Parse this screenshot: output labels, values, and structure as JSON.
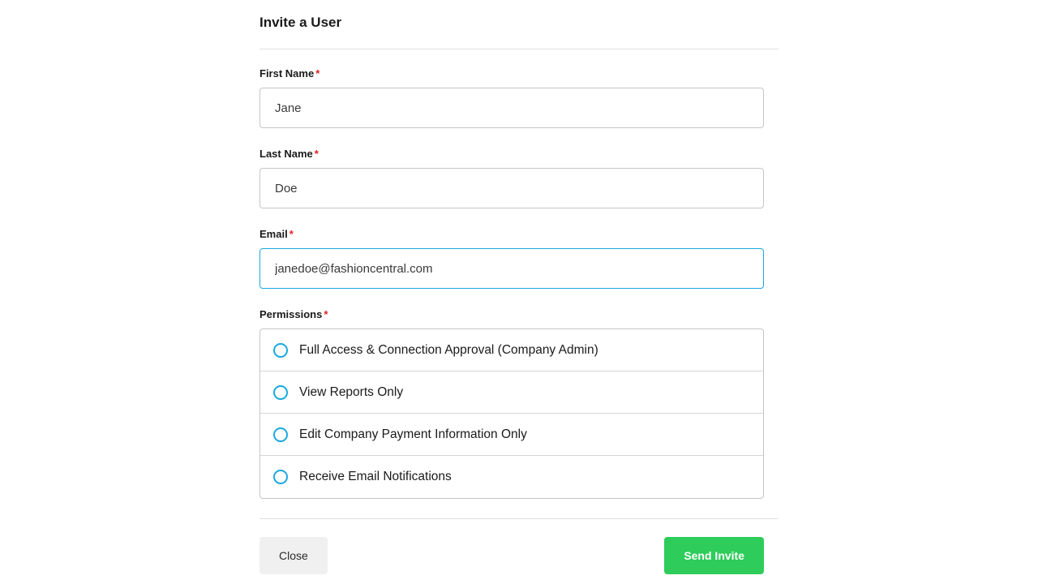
{
  "modal": {
    "title": "Invite a User"
  },
  "fields": {
    "first_name": {
      "label": "First Name",
      "value": "Jane"
    },
    "last_name": {
      "label": "Last Name",
      "value": "Doe"
    },
    "email": {
      "label": "Email",
      "value": "janedoe@fashioncentral.com"
    },
    "permissions": {
      "label": "Permissions",
      "options": [
        "Full Access & Connection Approval (Company Admin)",
        "View Reports Only",
        "Edit Company Payment Information Only",
        "Receive Email Notifications"
      ]
    }
  },
  "actions": {
    "close": "Close",
    "send": "Send Invite"
  },
  "required_marker": "*"
}
